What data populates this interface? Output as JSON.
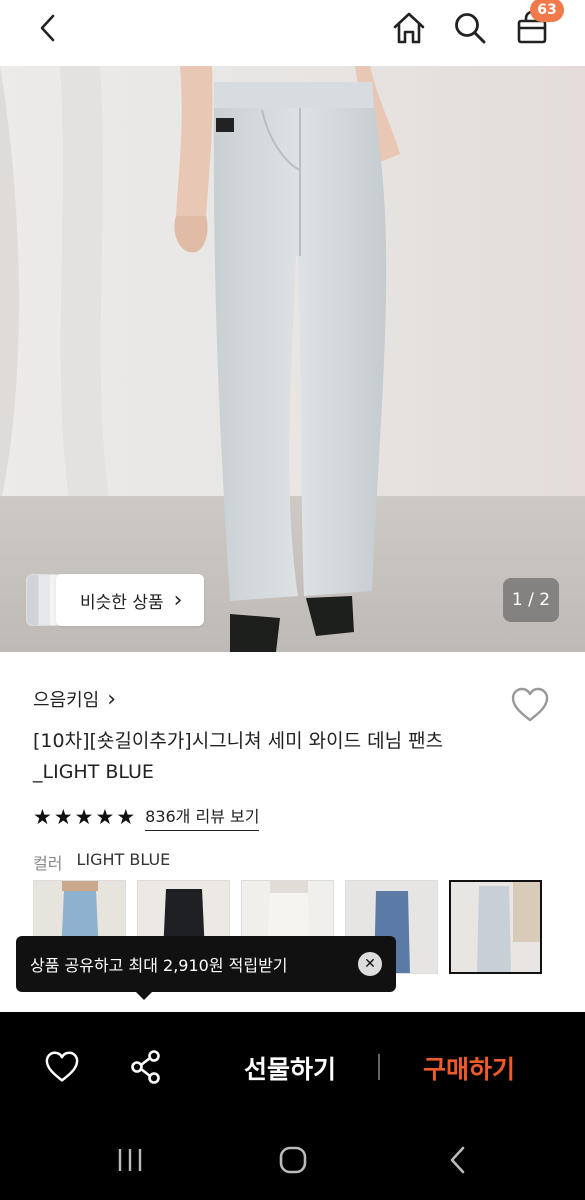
{
  "header": {
    "back_icon": "chevron-left-icon",
    "home_icon": "home-icon",
    "search_icon": "search-icon",
    "bag_icon": "shopping-bag-icon",
    "bag_badge": "63",
    "badge_color": "#f07a4a"
  },
  "hero": {
    "similar_label": "비슷한 상품",
    "similar_chevron": "›",
    "page_counter": "1 / 2"
  },
  "product": {
    "brand": "으음키임",
    "brand_chevron": "›",
    "title_line1": "[10차][숏길이추가]시그니쳐 세미 와이드 데님 팬츠",
    "title_line2": "_LIGHT BLUE",
    "rating_stars": 5,
    "review_link": "836개 리뷰 보기",
    "color_label": "컬러",
    "color_value": "LIGHT BLUE",
    "swatches": [
      "light-blue-jeans",
      "black-jeans",
      "ivory-jeans",
      "mid-blue-jeans",
      "light-blue-jeans-selected"
    ]
  },
  "tooltip": {
    "text": "상품 공유하고 최대 2,910원 적립받기",
    "close_icon": "close-icon"
  },
  "actions": {
    "heart_icon": "heart-icon",
    "share_icon": "share-icon",
    "gift_label": "선물하기",
    "buy_label": "구매하기",
    "buy_color": "#f05a28"
  },
  "system_nav": {
    "recent_icon": "recent-apps-icon",
    "home_icon": "home-circle-icon",
    "back_icon": "back-icon"
  }
}
